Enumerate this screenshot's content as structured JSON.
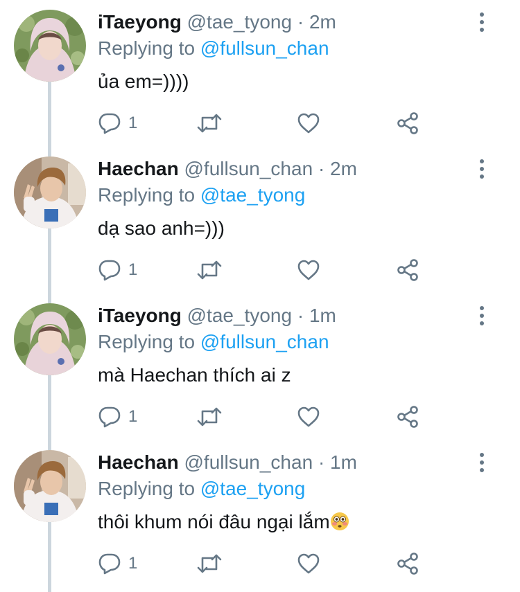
{
  "colors": {
    "name": "#14171a",
    "meta": "#657786",
    "mention": "#1da1f2",
    "thread_line": "#ccd6dd",
    "icon": "#657786"
  },
  "tweets": [
    {
      "name": "iTaeyong",
      "handle": "@tae_tyong",
      "separator": "·",
      "time": "2m",
      "replying_prefix": "Replying to",
      "replying_to": "@fullsun_chan",
      "text": "ủa em=))))",
      "reply_count": "1",
      "avatar_icon": "avatar-taeyong"
    },
    {
      "name": "Haechan",
      "handle": "@fullsun_chan",
      "separator": "·",
      "time": "2m",
      "replying_prefix": "Replying to",
      "replying_to": "@tae_tyong",
      "text": "dạ sao anh=)))",
      "reply_count": "1",
      "avatar_icon": "avatar-haechan"
    },
    {
      "name": "iTaeyong",
      "handle": "@tae_tyong",
      "separator": "·",
      "time": "1m",
      "replying_prefix": "Replying to",
      "replying_to": "@fullsun_chan",
      "text": "mà Haechan thích ai z",
      "reply_count": "1",
      "avatar_icon": "avatar-taeyong"
    },
    {
      "name": "Haechan",
      "handle": "@fullsun_chan",
      "separator": "·",
      "time": "1m",
      "replying_prefix": "Replying to",
      "replying_to": "@tae_tyong",
      "text": "thôi khum nói đâu ngại lắm",
      "text_emoji": "flushed-face-emoji",
      "reply_count": "1",
      "avatar_icon": "avatar-haechan"
    }
  ],
  "icons": {
    "reply": "reply-icon",
    "retweet": "retweet-icon",
    "like": "heart-icon",
    "share": "share-icon",
    "more": "more-vertical-icon"
  }
}
